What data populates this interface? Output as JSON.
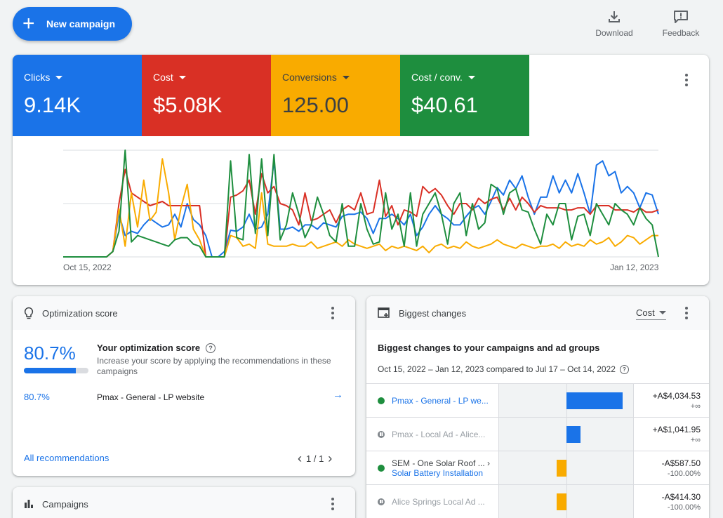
{
  "header": {
    "new_campaign_label": "New campaign",
    "download_label": "Download",
    "feedback_label": "Feedback"
  },
  "overview": {
    "metrics": [
      {
        "label": "Clicks",
        "value": "9.14K",
        "color": "#1a73e8"
      },
      {
        "label": "Cost",
        "value": "$5.08K",
        "color": "#d93025"
      },
      {
        "label": "Conversions",
        "value": "125.00",
        "color": "#f9ab00"
      },
      {
        "label": "Cost / conv.",
        "value": "$40.61",
        "color": "#1e8e3e"
      }
    ],
    "start_date": "Oct 15, 2022",
    "end_date": "Jan 12, 2023"
  },
  "chart_data": {
    "type": "line",
    "x_start": "Oct 15, 2022",
    "x_end": "Jan 12, 2023",
    "ylim": [
      0,
      1
    ],
    "grid": true,
    "series": [
      {
        "color": "#1a73e8",
        "values": [
          0,
          0,
          0,
          0,
          0,
          0,
          0,
          0,
          0.05,
          0.4,
          0.2,
          0.24,
          0.22,
          0.3,
          0.36,
          0.32,
          0.28,
          0.3,
          0.4,
          0.28,
          0.5,
          0.35,
          0.3,
          0.2,
          0,
          0,
          0.05,
          0.25,
          0.24,
          0.28,
          0.4,
          0.26,
          0.28,
          0.4,
          0.9,
          0.26,
          0.26,
          0.28,
          0.24,
          0.3,
          0.3,
          0.26,
          0.32,
          0.3,
          0.28,
          0.38,
          0.4,
          0.4,
          0.42,
          0.36,
          0.22,
          0.36,
          0.36,
          0.4,
          0.36,
          0.3,
          0.4,
          0.2,
          0.28,
          0.4,
          0.48,
          0.4,
          0.36,
          0.3,
          0.3,
          0.38,
          0.45,
          0.48,
          0.4,
          0.52,
          0.65,
          0.58,
          0.72,
          0.64,
          0.76,
          0.56,
          0.4,
          0.56,
          0.56,
          0.76,
          0.6,
          0.72,
          0.6,
          0.78,
          0.6,
          0.4,
          0.86,
          0.9,
          0.76,
          0.8,
          0.6,
          0.66,
          0.6,
          0.46,
          0.6,
          0.58,
          0.4
        ]
      },
      {
        "color": "#d93025",
        "values": [
          0,
          0,
          0,
          0,
          0,
          0,
          0,
          0,
          0.05,
          0.5,
          0.82,
          0.6,
          0.56,
          0.52,
          0.48,
          0.5,
          0.52,
          0.48,
          0.48,
          0.48,
          0.48,
          0.48,
          0.48,
          0,
          0,
          0,
          0,
          0.56,
          0.58,
          0.62,
          0.72,
          0.4,
          0.78,
          0.6,
          0.66,
          0.5,
          0.48,
          0.44,
          0.3,
          0.6,
          0.34,
          0.36,
          0.4,
          0.44,
          0.32,
          0.44,
          0.48,
          0.44,
          0.6,
          0.4,
          0.42,
          0.72,
          0.38,
          0.48,
          0.3,
          0.44,
          0.42,
          0.38,
          0.66,
          0.6,
          0.64,
          0.58,
          0.48,
          0.4,
          0.5,
          0.5,
          0.44,
          0.55,
          0.5,
          0.54,
          0.56,
          0.44,
          0.55,
          0.44,
          0.56,
          0.5,
          0.42,
          0.48,
          0.46,
          0.46,
          0.46,
          0.44,
          0.44,
          0.46,
          0.46,
          0.4,
          0.48,
          0.48,
          0.48,
          0.44,
          0.44,
          0.44,
          0.42,
          0.46,
          0.42,
          0.42,
          0.44
        ]
      },
      {
        "color": "#f9ab00",
        "values": [
          0,
          0,
          0,
          0,
          0,
          0,
          0,
          0,
          0.05,
          0.45,
          0.1,
          0.6,
          0.28,
          0.72,
          0.34,
          0.42,
          0.92,
          0.6,
          0.16,
          0.46,
          0.68,
          0.26,
          0.16,
          0,
          0,
          0,
          0,
          0.2,
          0.18,
          0.1,
          0.12,
          0.08,
          0.6,
          0.12,
          0.1,
          0.1,
          0.1,
          0.12,
          0.1,
          0.1,
          0.14,
          0.08,
          0.1,
          0.12,
          0.14,
          0.1,
          0.16,
          0.12,
          0.1,
          0.08,
          0.1,
          0.12,
          0.06,
          0.1,
          0.08,
          0.1,
          0.08,
          0.06,
          0.1,
          0.04,
          0.1,
          0.12,
          0.08,
          0.1,
          0.08,
          0.14,
          0.1,
          0.08,
          0.1,
          0.12,
          0.16,
          0.12,
          0.1,
          0.08,
          0.12,
          0.1,
          0.08,
          0.1,
          0.1,
          0.12,
          0.08,
          0.14,
          0.1,
          0.12,
          0.1,
          0.16,
          0.12,
          0.14,
          0.18,
          0.1,
          0.14,
          0.2,
          0.18,
          0.12,
          0.16,
          0.2,
          0.2
        ]
      },
      {
        "color": "#1e8e3e",
        "values": [
          0,
          0,
          0,
          0,
          0,
          0,
          0,
          0,
          0.05,
          0.24,
          1,
          0.14,
          0.2,
          0.18,
          0.16,
          0.14,
          0.12,
          0.1,
          0.16,
          0.18,
          0.18,
          0.12,
          0.1,
          0,
          0,
          0,
          0,
          0.9,
          0.18,
          0.16,
          0.96,
          0.22,
          0.92,
          0.2,
          0.96,
          0.16,
          0.3,
          0.6,
          0.4,
          0.18,
          0.3,
          0.56,
          0.4,
          0.2,
          0.14,
          0.5,
          0.1,
          0.1,
          0.5,
          0.26,
          0.12,
          0.14,
          0.6,
          0.26,
          0.4,
          0.1,
          0.6,
          0.1,
          0.4,
          0.5,
          0.6,
          0.4,
          0.12,
          0.5,
          0.6,
          0.2,
          0.5,
          0.26,
          0.32,
          0.68,
          0.64,
          0.4,
          0.6,
          0.64,
          0.44,
          0.42,
          0.26,
          0.12,
          0.4,
          0.3,
          0.5,
          0.5,
          0.16,
          0.38,
          0.4,
          0.2,
          0.5,
          0.4,
          0.3,
          0.5,
          0.44,
          0.4,
          0.3,
          0.46,
          0.36,
          0.3,
          0
        ]
      }
    ]
  },
  "optimization": {
    "title": "Optimization score",
    "score": "80.7%",
    "score_fraction": 0.807,
    "heading": "Your optimization score",
    "description": "Increase your score by applying the recommendations in these campaigns",
    "row_score": "80.7%",
    "row_campaign": "Pmax - General - LP website",
    "all_recommendations": "All recommendations",
    "pager": "1 / 1"
  },
  "campaigns": {
    "title": "Campaigns"
  },
  "biggest_changes": {
    "title": "Biggest changes",
    "metric": "Cost",
    "heading": "Biggest changes to your campaigns and ad groups",
    "subheading": "Oct 15, 2022 – Jan 12, 2023 compared to Jul 17 – Oct 14, 2022",
    "rows": [
      {
        "name": "Pmax - General - LP we...",
        "sub": "",
        "status": "enabled",
        "value": "+A$4,034.53",
        "pct": "+∞",
        "change": 4034.53
      },
      {
        "name": "Pmax - Local Ad - Alice...",
        "sub": "",
        "status": "paused",
        "value": "+A$1,041.95",
        "pct": "+∞",
        "change": 1041.95
      },
      {
        "name": "SEM - One Solar Roof ... ›",
        "sub": "Solar Battery Installation",
        "status": "enabled",
        "value": "-A$587.50",
        "pct": "-100.00%",
        "change": -587.5
      },
      {
        "name": "Alice Springs Local Ad ...",
        "sub": "",
        "status": "paused",
        "value": "-A$414.30",
        "pct": "-100.00%",
        "change": -414.3
      }
    ]
  }
}
